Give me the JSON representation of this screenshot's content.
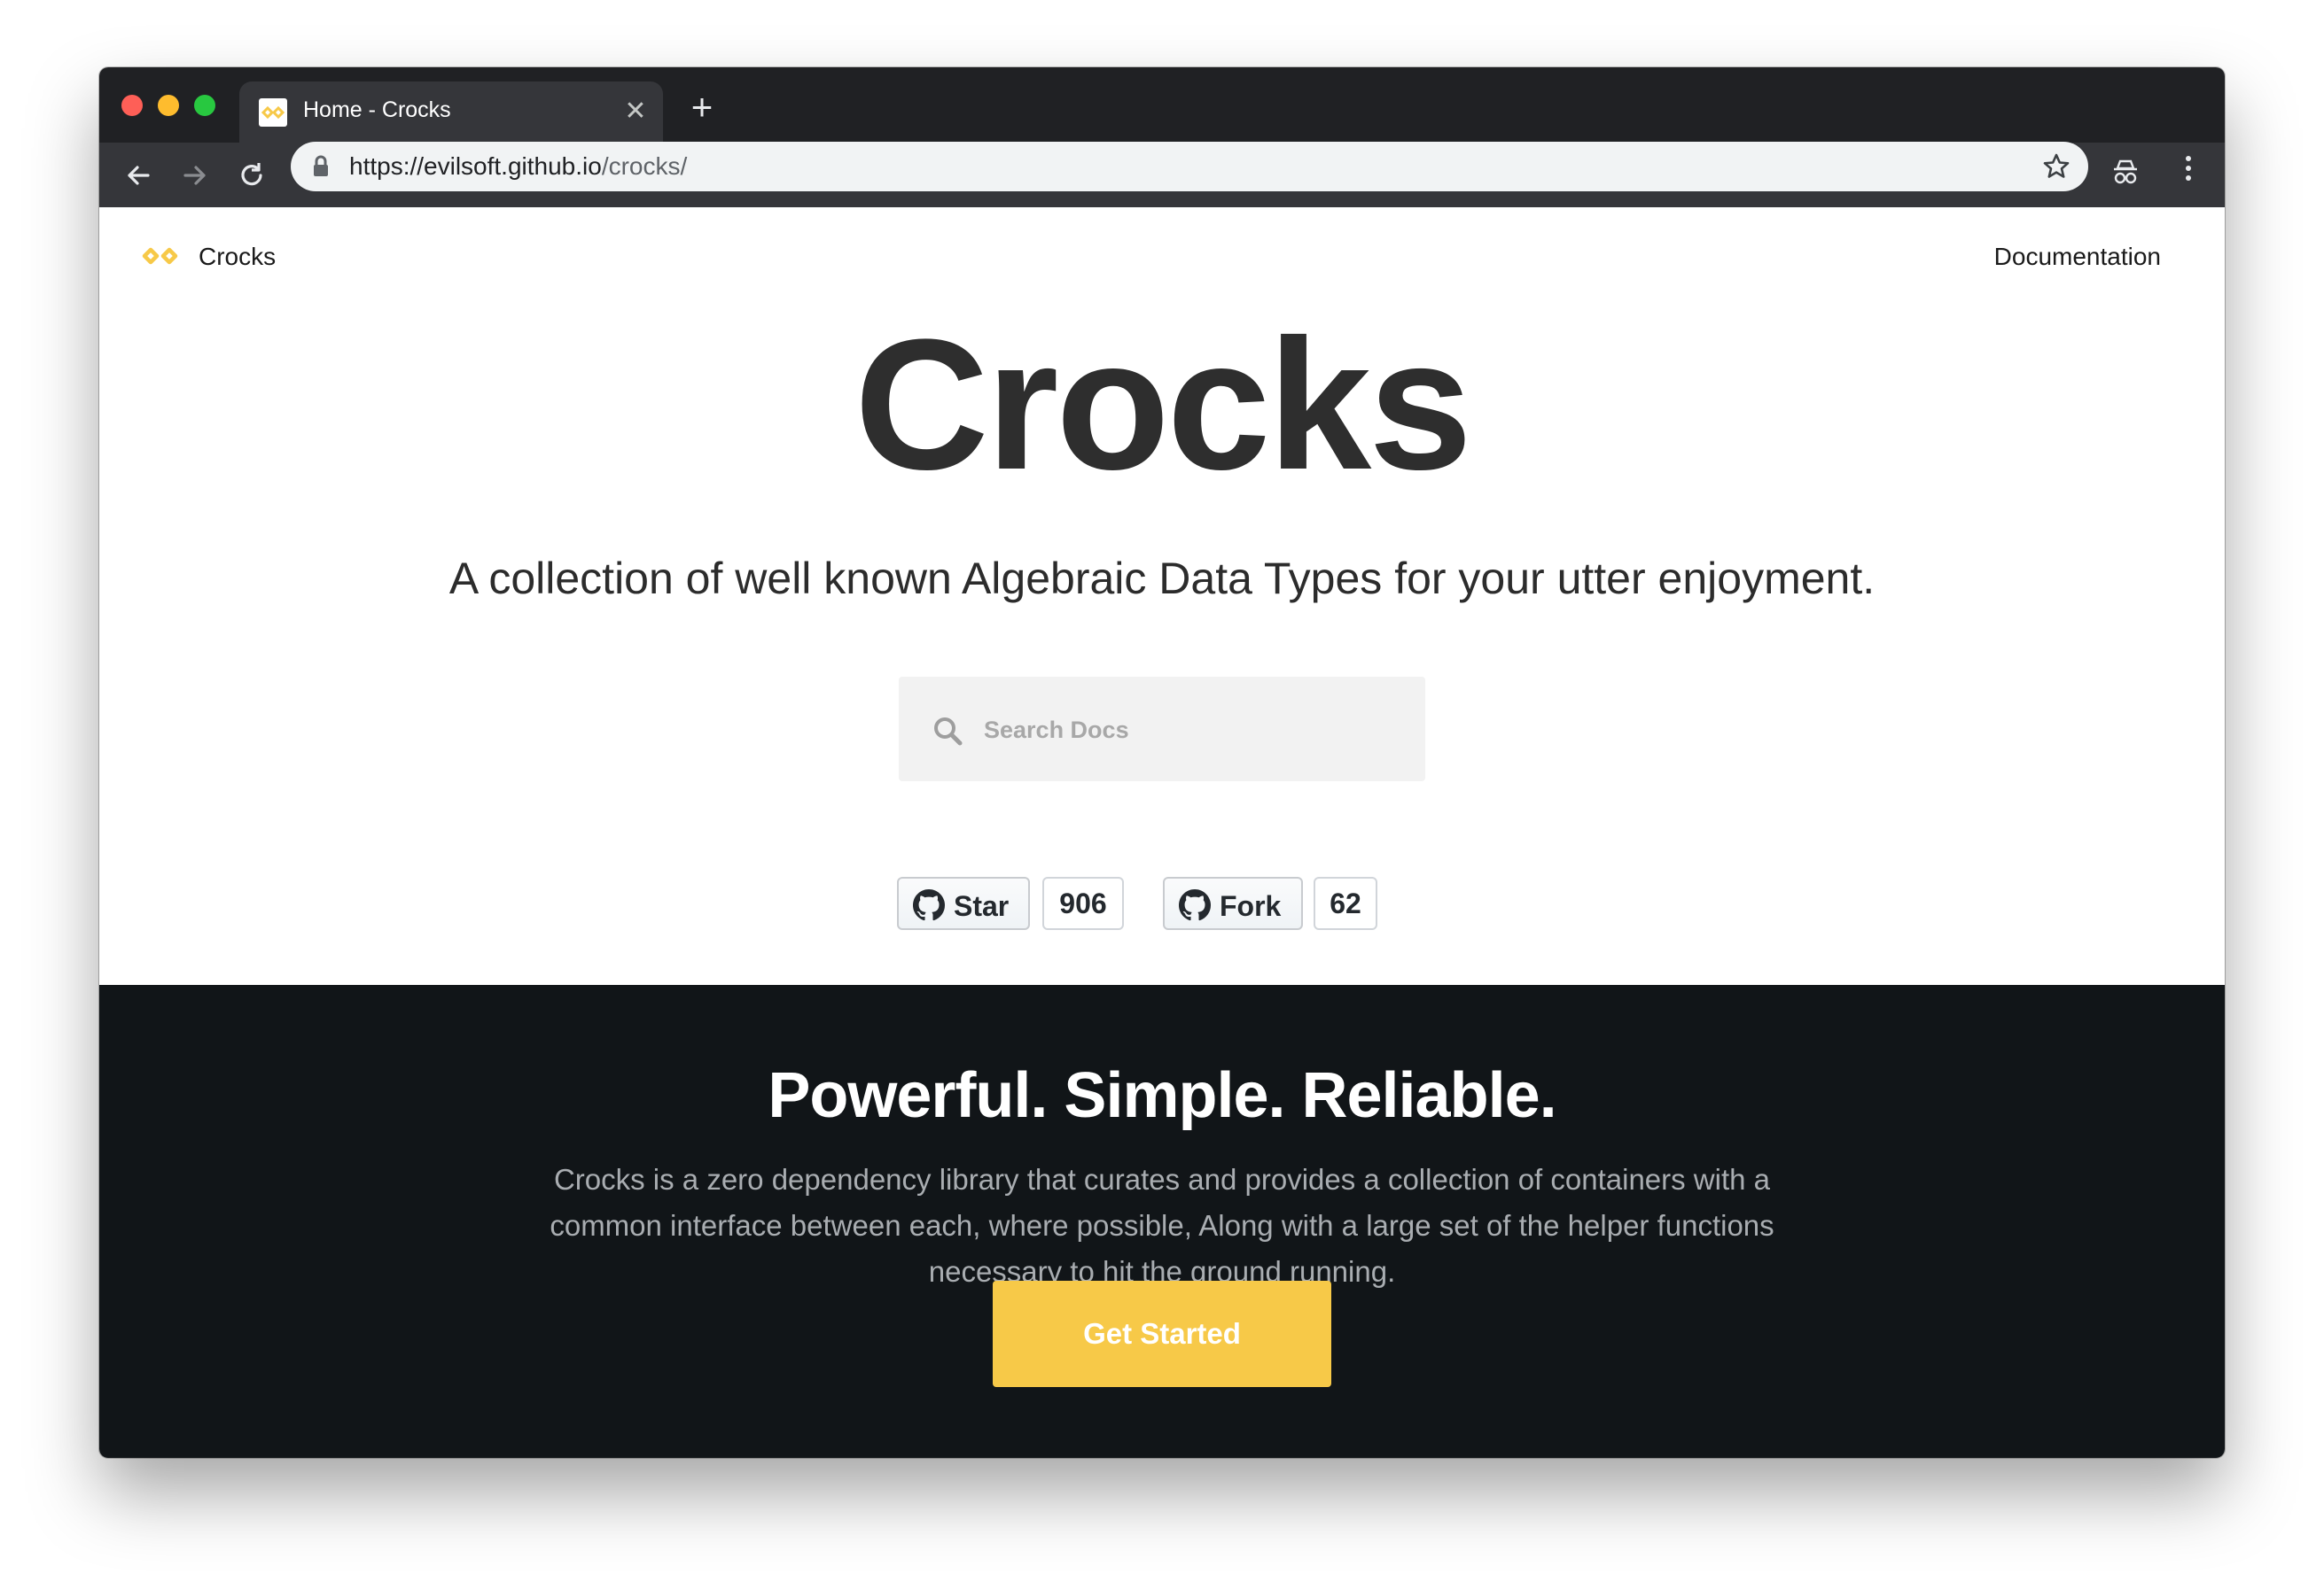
{
  "browser": {
    "tab_title": "Home - Crocks",
    "tab_close": "✕",
    "new_tab": "+",
    "url_host": "https://evilsoft.github.io",
    "url_path": "/crocks/"
  },
  "nav": {
    "site_name": "Crocks",
    "doc_link": "Documentation"
  },
  "hero": {
    "title": "Crocks",
    "subtitle": "A collection of well known Algebraic Data Types for your utter enjoyment."
  },
  "search": {
    "placeholder": "Search Docs",
    "value": ""
  },
  "github": {
    "star_label": "Star",
    "star_count": "906",
    "fork_label": "Fork",
    "fork_count": "62"
  },
  "features": {
    "tagline": "Powerful. Simple. Reliable.",
    "description": "Crocks is a zero dependency library that curates and provides a collection of containers with a common interface between each, where possible, Along with a large set of the helper functions necessary to hit the ground running.",
    "cta_label": "Get Started"
  },
  "colors": {
    "accent": "#f7c948",
    "dark_bg": "#111518",
    "title": "#2e2e2e"
  }
}
